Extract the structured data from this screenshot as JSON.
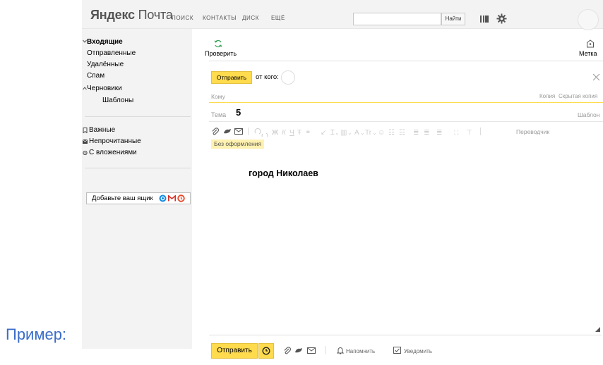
{
  "header": {
    "logo_brand": "Яндекс",
    "logo_product": "Почта",
    "nav": [
      "ПОИСК",
      "КОНТАКТЫ",
      "ДИСК",
      "ЕЩЁ"
    ],
    "search_value": "",
    "find_label": "Найти"
  },
  "sidebar": {
    "folders": [
      {
        "label": "Входящие",
        "bold": true,
        "arrow": "down"
      },
      {
        "label": "Отправленные"
      },
      {
        "label": "Удалённые"
      },
      {
        "label": "Спам"
      },
      {
        "label": "Черновики",
        "arrow": "up"
      },
      {
        "label": "Шаблоны",
        "indent": true
      }
    ],
    "labels": [
      {
        "label": "Важные",
        "icon": "bookmark-icon"
      },
      {
        "label": "Непрочитанные",
        "icon": "envelope-icon"
      },
      {
        "label": "С вложениями",
        "icon": "paperclip-icon"
      }
    ],
    "add_mailbox": "Добавьте ваш ящик"
  },
  "toolbar": {
    "check_label": "Проверить",
    "label_label": "Метка"
  },
  "compose": {
    "send_label": "Отправить",
    "from_label": "от кого:",
    "to_placeholder": "Кому",
    "copy_label": "Копия",
    "bcc_label": "Скрытая копия",
    "subject_label": "Тема",
    "subject_value": "5",
    "template_label": "Шаблон",
    "translator_label": "Переводчик",
    "plain_format_label": "Без оформления",
    "body_text": "город Николаев"
  },
  "footer": {
    "send_label": "Отправить",
    "remind_label": "Напомнить",
    "notify_label": "Уведомить"
  },
  "caption": "Пример:",
  "colors": {
    "accent_yellow": "#ffdb4d",
    "sidebar_bg": "#f3f3f3",
    "caption_blue": "#3b6cc9",
    "refresh_green": "#3aa35a"
  }
}
